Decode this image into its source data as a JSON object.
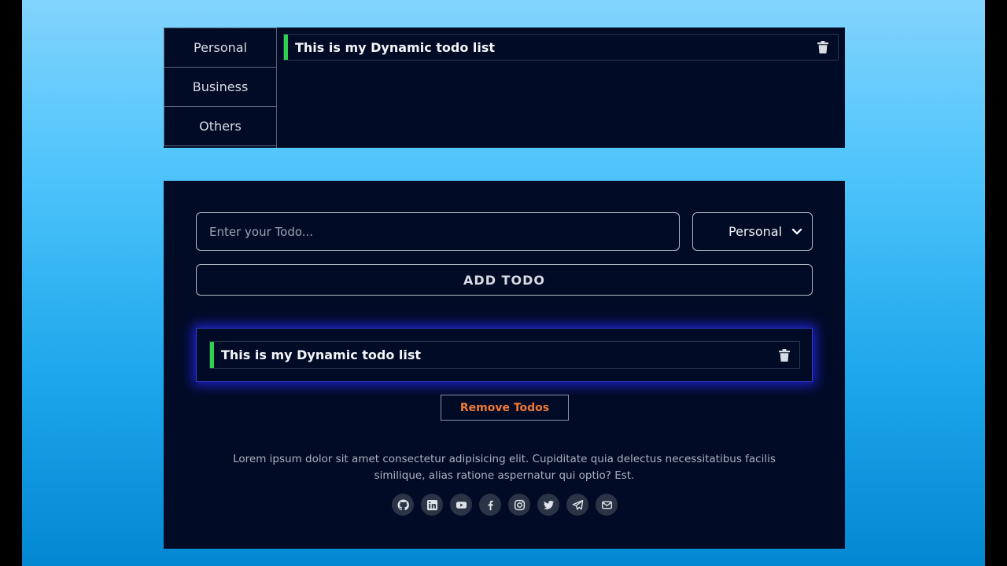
{
  "categories": [
    "Personal",
    "Business",
    "Others"
  ],
  "top_list": {
    "todo_text": "This is my Dynamic todo list"
  },
  "form": {
    "input_placeholder": "Enter your Todo...",
    "selected_category": "Personal",
    "add_button": "ADD TODO"
  },
  "bottom_list": {
    "todo_text": "This is my Dynamic todo list"
  },
  "remove_button": "Remove Todos",
  "footer": {
    "text": "Lorem ipsum dolor sit amet consectetur adipisicing elit. Cupiditate quia delectus necessitatibus facilis similique, alias ratione aspernatur qui optio? Est.",
    "socials": [
      "github-icon",
      "linkedin-icon",
      "youtube-icon",
      "facebook-icon",
      "instagram-icon",
      "twitter-icon",
      "telegram-icon",
      "mail-icon"
    ]
  },
  "colors": {
    "accent_green": "#2fd04d",
    "remove_orange": "#f07a35",
    "panel_bg": "#020b26",
    "glow_blue": "#2828ff"
  }
}
